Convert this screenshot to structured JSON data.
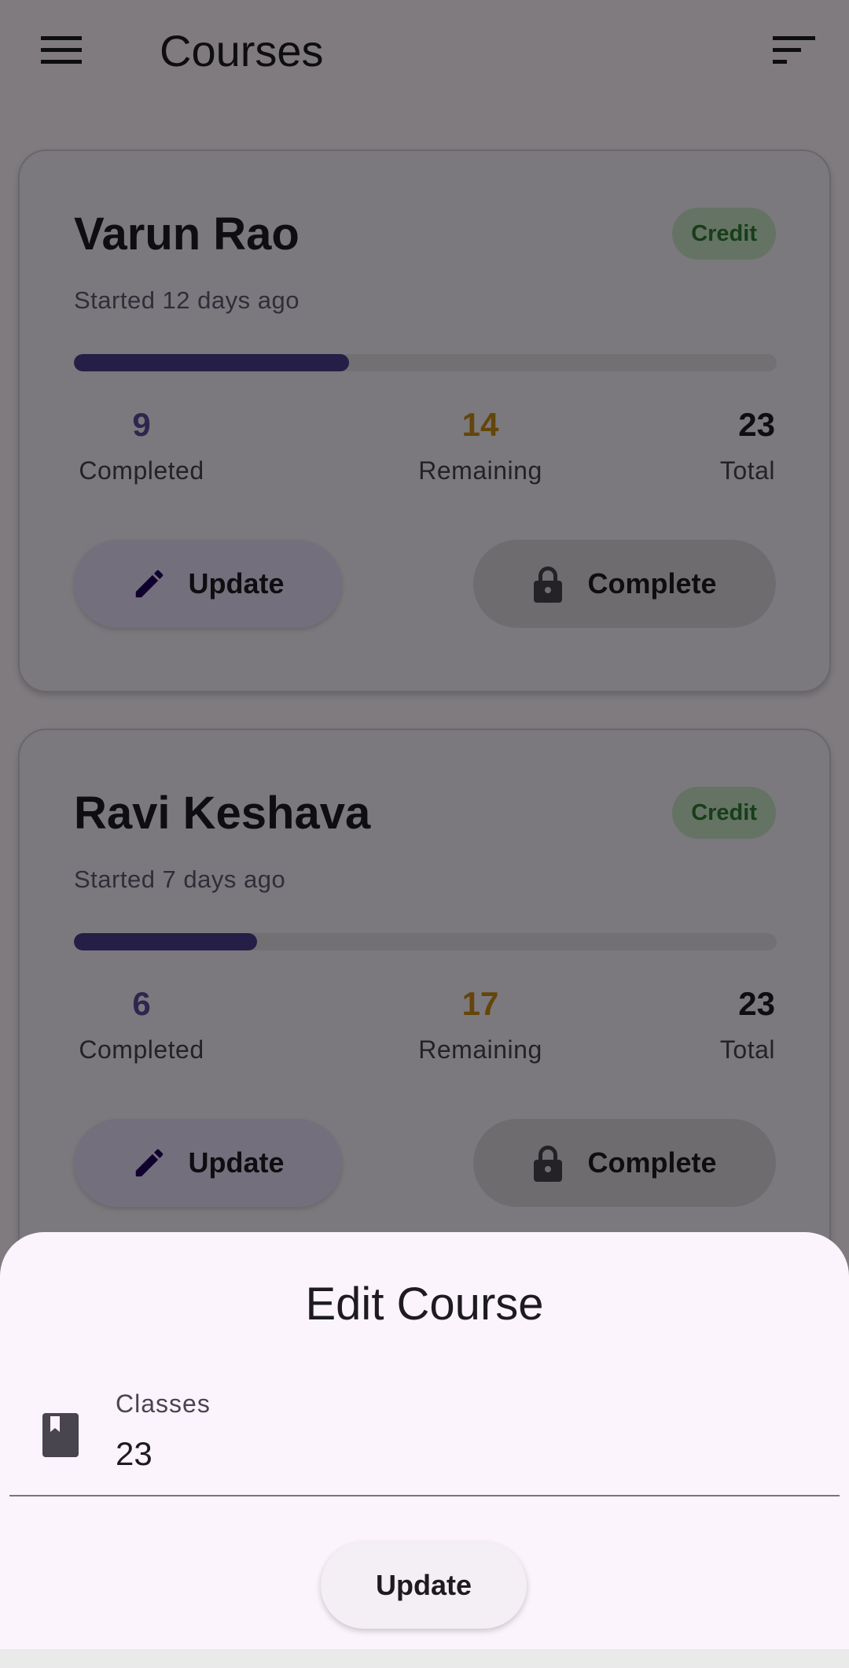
{
  "appbar": {
    "title": "Courses",
    "menu_icon": "menu-icon",
    "filter_icon": "sort-icon"
  },
  "courses": [
    {
      "name": "Varun Rao",
      "badge": "Credit",
      "started": "Started 12 days ago",
      "completed": "9",
      "completed_label": "Completed",
      "remaining": "14",
      "remaining_label": "Remaining",
      "total": "23",
      "total_label": "Total",
      "progress_fraction": 0.3913,
      "update_label": "Update",
      "complete_label": "Complete"
    },
    {
      "name": "Ravi Keshava",
      "badge": "Credit",
      "started": "Started 7 days ago",
      "completed": "6",
      "completed_label": "Completed",
      "remaining": "17",
      "remaining_label": "Remaining",
      "total": "23",
      "total_label": "Total",
      "progress_fraction": 0.2609,
      "update_label": "Update",
      "complete_label": "Complete"
    }
  ],
  "sheet": {
    "title": "Edit Course",
    "field_label": "Classes",
    "field_value": "23",
    "field_icon": "book-icon",
    "button_label": "Update"
  },
  "colors": {
    "accent": "#4a3f8e",
    "remaining": "#c98a14",
    "badge_bg": "#c8e6c9",
    "badge_fg": "#2e7d32"
  }
}
